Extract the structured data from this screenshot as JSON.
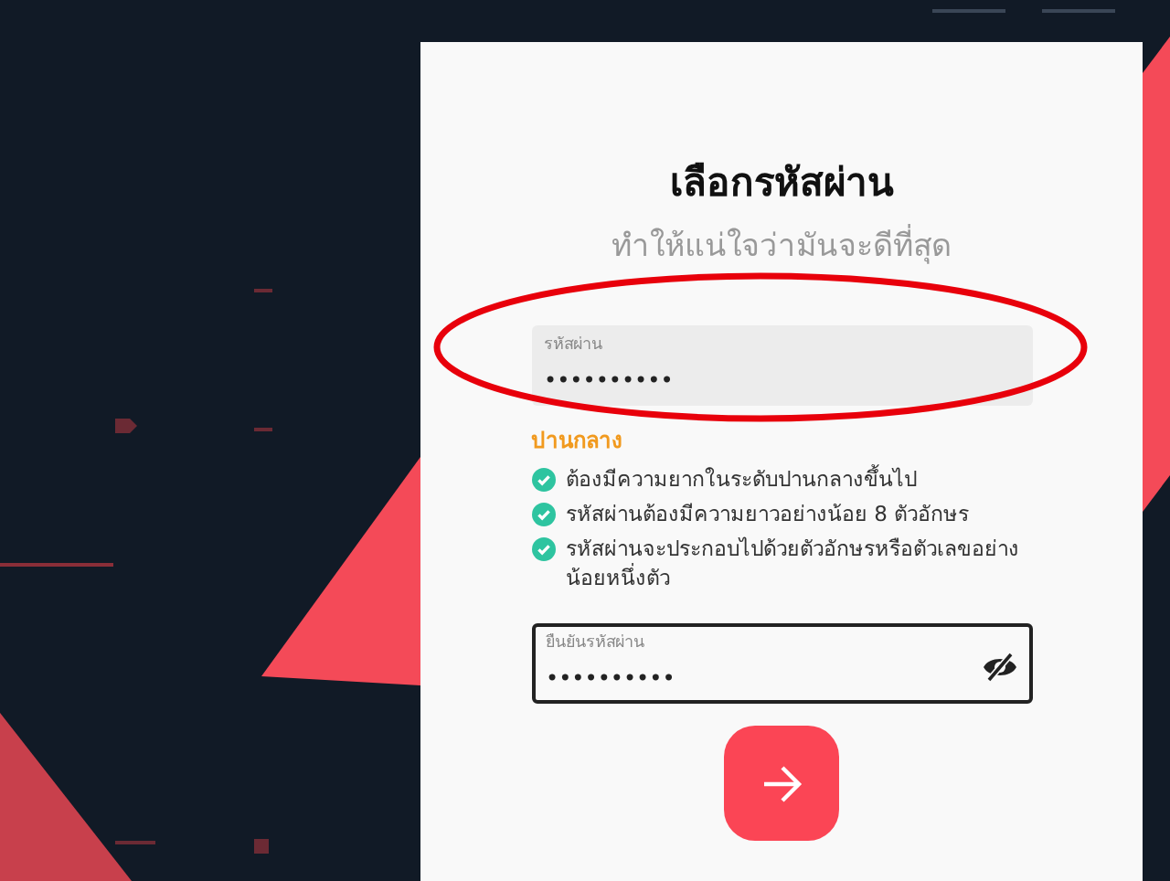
{
  "title": "เลือกรหัสผ่าน",
  "subtitle": "ทำให้แน่ใจว่ามันจะดีที่สุด",
  "password_field": {
    "label": "รหัสผ่าน",
    "value": "••••••••••"
  },
  "strength": {
    "label": "ปานกลาง"
  },
  "requirements": [
    {
      "text": "ต้องมีความยากในระดับปานกลางขึ้นไป",
      "met": true
    },
    {
      "text": "รหัสผ่านต้องมีความยาวอย่างน้อย 8 ตัวอักษร",
      "met": true
    },
    {
      "text": "รหัสผ่านจะประกอบไปด้วยตัวอักษรหรือตัวเลขอย่างน้อยหนึ่งตัว",
      "met": true
    }
  ],
  "confirm_field": {
    "label": "ยืนยันรหัสผ่าน",
    "value": "••••••••••",
    "visible": false
  },
  "annotation": {
    "kind": "ellipse"
  }
}
